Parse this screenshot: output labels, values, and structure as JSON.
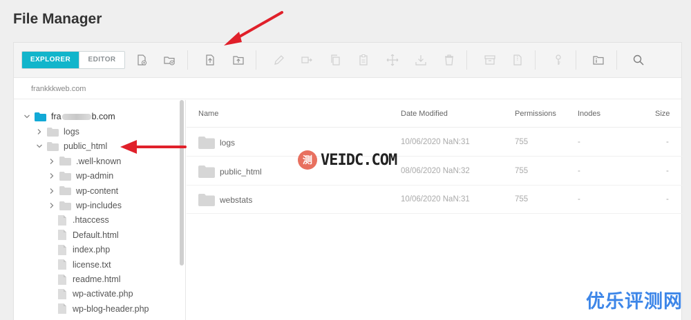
{
  "page": {
    "title": "File Manager"
  },
  "toolbar": {
    "modes": [
      {
        "label": "EXPLORER",
        "active": true
      },
      {
        "label": "EDITOR",
        "active": false
      }
    ],
    "icons": [
      "new-file-icon",
      "new-folder-icon",
      "upload-file-icon",
      "upload-folder-icon",
      "rename-icon",
      "move-icon",
      "copy-icon",
      "paste-icon",
      "drag-icon",
      "download-icon",
      "delete-icon",
      "archive-icon",
      "extract-icon",
      "permissions-icon",
      "properties-icon",
      "search-icon"
    ]
  },
  "path": {
    "text": "frankkkweb.com"
  },
  "tree": {
    "root": {
      "label_start": "fra",
      "label_end": "b.com"
    },
    "items": [
      {
        "label": "logs",
        "type": "folder",
        "level": 1,
        "expanded": false
      },
      {
        "label": "public_html",
        "type": "folder",
        "level": 1,
        "expanded": true
      },
      {
        "label": ".well-known",
        "type": "folder",
        "level": 2,
        "expanded": false
      },
      {
        "label": "wp-admin",
        "type": "folder",
        "level": 2,
        "expanded": false
      },
      {
        "label": "wp-content",
        "type": "folder",
        "level": 2,
        "expanded": false
      },
      {
        "label": "wp-includes",
        "type": "folder",
        "level": 2,
        "expanded": false
      },
      {
        "label": ".htaccess",
        "type": "file",
        "level": 2
      },
      {
        "label": "Default.html",
        "type": "file",
        "level": 2
      },
      {
        "label": "index.php",
        "type": "file",
        "level": 2
      },
      {
        "label": "license.txt",
        "type": "file",
        "level": 2
      },
      {
        "label": "readme.html",
        "type": "file",
        "level": 2
      },
      {
        "label": "wp-activate.php",
        "type": "file",
        "level": 2
      },
      {
        "label": "wp-blog-header.php",
        "type": "file",
        "level": 2
      }
    ]
  },
  "list": {
    "columns": [
      "Name",
      "Date Modified",
      "Permissions",
      "Inodes",
      "Size"
    ],
    "rows": [
      {
        "name": "logs",
        "date": "10/06/2020 NaN:31",
        "permissions": "755",
        "inodes": "-",
        "size": "-"
      },
      {
        "name": "public_html",
        "date": "08/06/2020 NaN:32",
        "permissions": "755",
        "inodes": "-",
        "size": "-"
      },
      {
        "name": "webstats",
        "date": "10/06/2020 NaN:31",
        "permissions": "755",
        "inodes": "-",
        "size": "-"
      }
    ]
  },
  "watermark": {
    "badge": "测",
    "text": "VEIDC.COM",
    "corner": "优乐评测网"
  },
  "colors": {
    "accent": "#12b5cb",
    "arrow": "#e0202a",
    "folder": "#d6d6d6",
    "root_folder": "#12a9d6"
  }
}
